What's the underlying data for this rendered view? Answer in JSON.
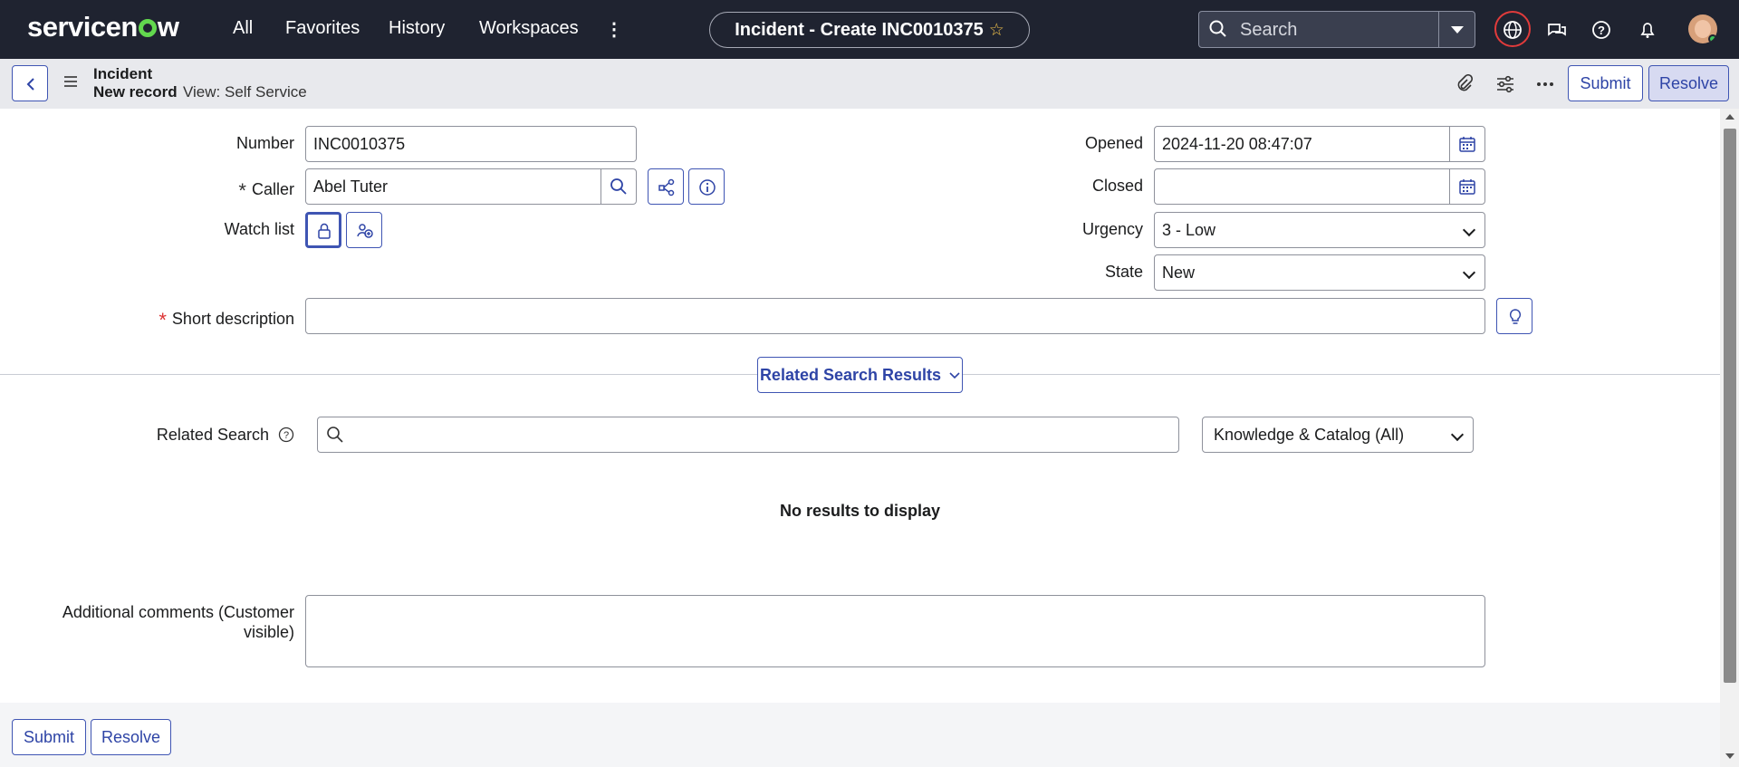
{
  "nav": {
    "logo": "servicenow",
    "items": [
      "All",
      "Favorites",
      "History",
      "Workspaces"
    ],
    "record_title": "Incident - Create INC0010375",
    "search_placeholder": "Search"
  },
  "record": {
    "table": "Incident",
    "status": "New record",
    "view": "View: Self Service",
    "submit_label": "Submit",
    "resolve_label": "Resolve"
  },
  "form": {
    "number_label": "Number",
    "number_value": "INC0010375",
    "caller_label": "Caller",
    "caller_value": "Abel Tuter",
    "watchlist_label": "Watch list",
    "opened_label": "Opened",
    "opened_value": "2024-11-20 08:47:07",
    "closed_label": "Closed",
    "closed_value": "",
    "urgency_label": "Urgency",
    "urgency_value": "3 - Low",
    "state_label": "State",
    "state_value": "New",
    "short_desc_label": "Short description",
    "short_desc_value": "",
    "related_results_label": "Related Search Results",
    "related_search_label": "Related Search",
    "related_search_value": "",
    "related_scope": "Knowledge & Catalog (All)",
    "no_results": "No results to display",
    "additional_comments_label_1": "Additional comments (Customer",
    "additional_comments_label_2": "visible)"
  },
  "footer": {
    "submit_label": "Submit",
    "resolve_label": "Resolve"
  }
}
